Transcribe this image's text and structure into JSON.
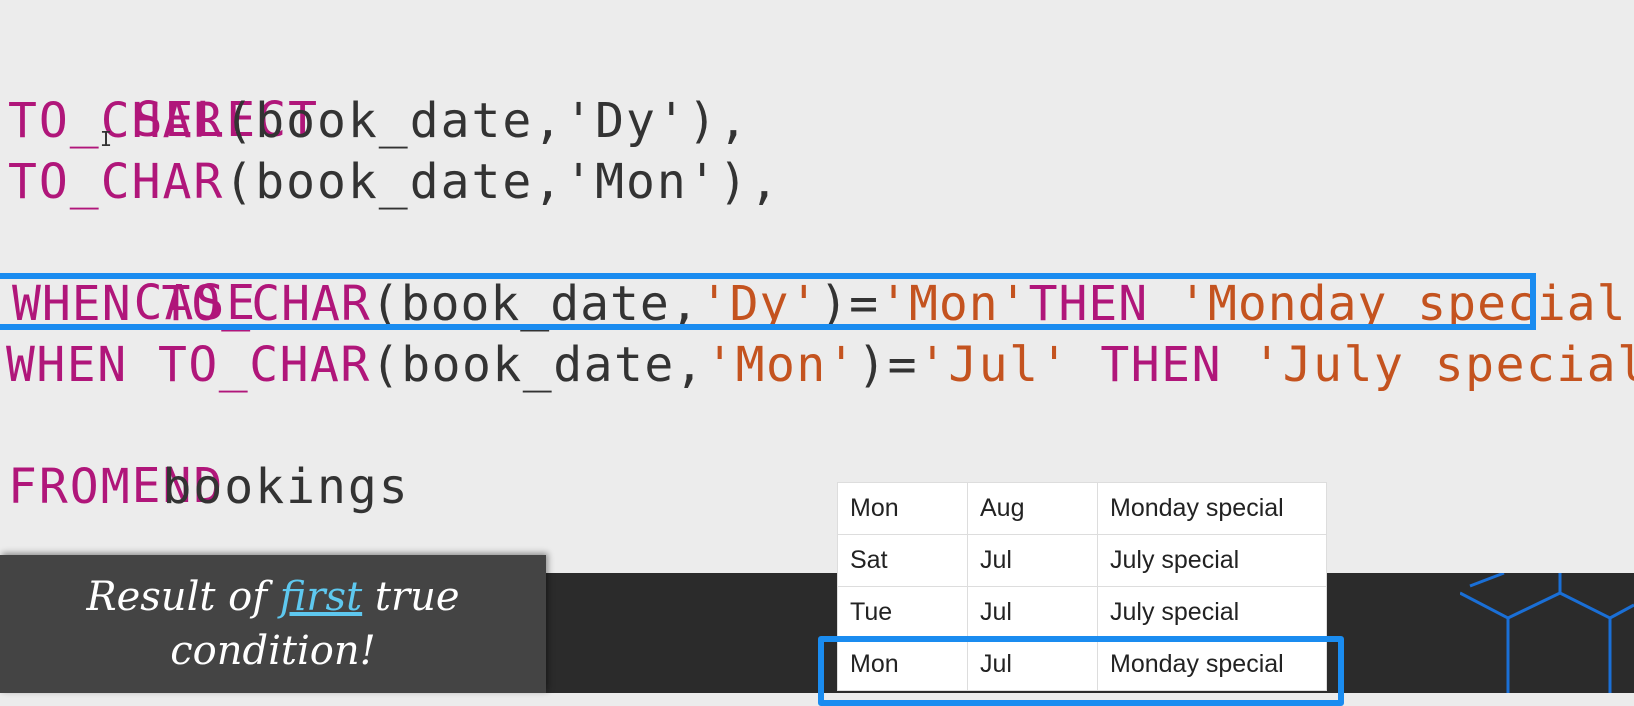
{
  "code": {
    "line1": {
      "kw": "SELECT"
    },
    "line2": {
      "kw": "TO_CHAR",
      "rest": "(book_date,'Dy'),"
    },
    "line3": {
      "kw": "TO_CHAR",
      "rest": "(book_date,'Mon'),"
    },
    "line4": {
      "kw": "CASE"
    },
    "line5": {
      "kw1": "WHEN",
      "kw2": "TO_CHAR",
      "p1": "(book_date,",
      "s1": "'Dy'",
      "p2": ")=",
      "s2": "'Mon'",
      "kw3": "THEN",
      "s3": "'Monday special'"
    },
    "line6": {
      "kw1": "WHEN",
      "kw2": "TO_CHAR",
      "p1": "(book_date,",
      "s1": "'Mon'",
      "p2": ")=",
      "s2": "'Jul'",
      "kw3": " THEN ",
      "s3": "'July special'"
    },
    "line7": {
      "kw": "END"
    },
    "line8": {
      "kw": "FROM",
      "rest": " bookings"
    }
  },
  "caption": {
    "part1": "Result of ",
    "emphasis": "first",
    "part2": " true condition!"
  },
  "results": [
    {
      "day": "Mon",
      "month": "Aug",
      "label": "Monday special"
    },
    {
      "day": "Sat",
      "month": "Jul",
      "label": "July special"
    },
    {
      "day": "Tue",
      "month": "Jul",
      "label": "July special"
    },
    {
      "day": "Mon",
      "month": "Jul",
      "label": "Monday special"
    }
  ],
  "colors": {
    "keyword": "#b0167a",
    "string": "#c4531f",
    "highlight": "#1a8cf0",
    "caption_emphasis": "#5ec8ef"
  }
}
